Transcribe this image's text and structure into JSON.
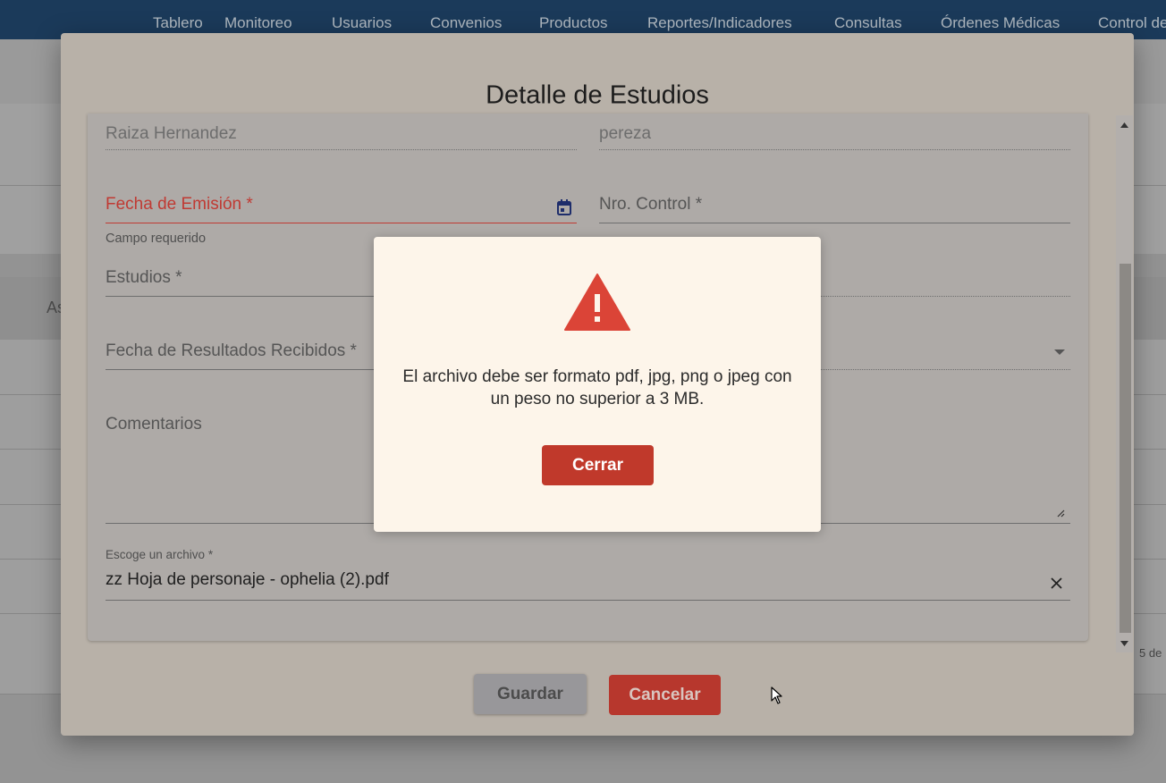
{
  "nav": {
    "items": [
      "Tablero",
      "Monitoreo",
      "Usuarios",
      "Convenios",
      "Productos",
      "Reportes/Indicadores",
      "Consultas",
      "Órdenes Médicas",
      "Control de"
    ]
  },
  "background": {
    "side_text": "As",
    "pagination_text": "5 de"
  },
  "dialog": {
    "title": "Detalle de Estudios",
    "fields": {
      "patient_name": "Raiza Hernandez",
      "other_value": "pereza",
      "emission_date_label": "Fecha de Emisión *",
      "emission_date_error": "Campo requerido",
      "control_number_label": "Nro. Control *",
      "studies_label": "Estudios *",
      "results_date_label": "Fecha de Resultados Recibidos *",
      "comments_label": "Comentarios",
      "file_label": "Escoge un archivo *",
      "file_value": "zz Hoja de personaje - ophelia (2).pdf"
    },
    "buttons": {
      "save": "Guardar",
      "cancel": "Cancelar"
    }
  },
  "alert": {
    "icon": "warning-triangle-icon",
    "message": "El archivo debe ser formato pdf, jpg, png o jpeg con un peso no superior a 3 MB.",
    "close_label": "Cerrar"
  },
  "colors": {
    "nav_bg": "#1d3e5f",
    "error_red": "#c03a33",
    "alert_bg": "#fdf5ea",
    "warning_icon": "#db4437",
    "primary_button": "#c0392b"
  }
}
